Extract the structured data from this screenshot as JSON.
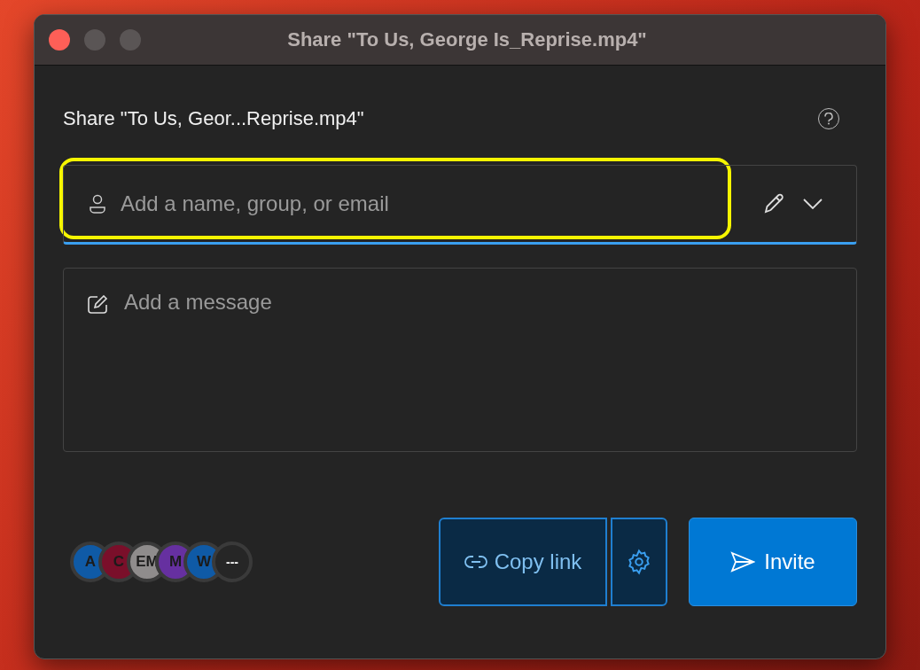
{
  "window": {
    "title": "Share \"To Us, George Is_Reprise.mp4\""
  },
  "heading": "Share \"To Us, Geor...Reprise.mp4\"",
  "recipient_field": {
    "placeholder": "Add a name, group, or email",
    "highlighted": true
  },
  "message_field": {
    "placeholder": "Add a message"
  },
  "avatars": [
    {
      "initials": "A",
      "color": "#0f5aa6"
    },
    {
      "initials": "C",
      "color": "#7a0f2a"
    },
    {
      "initials": "EM",
      "color": "#8f8c8c"
    },
    {
      "initials": "M",
      "color": "#6630a0"
    },
    {
      "initials": "W",
      "color": "#0f5aa6"
    },
    {
      "initials": "---",
      "color": "#262626"
    }
  ],
  "buttons": {
    "copy_link": "Copy link",
    "invite": "Invite"
  }
}
